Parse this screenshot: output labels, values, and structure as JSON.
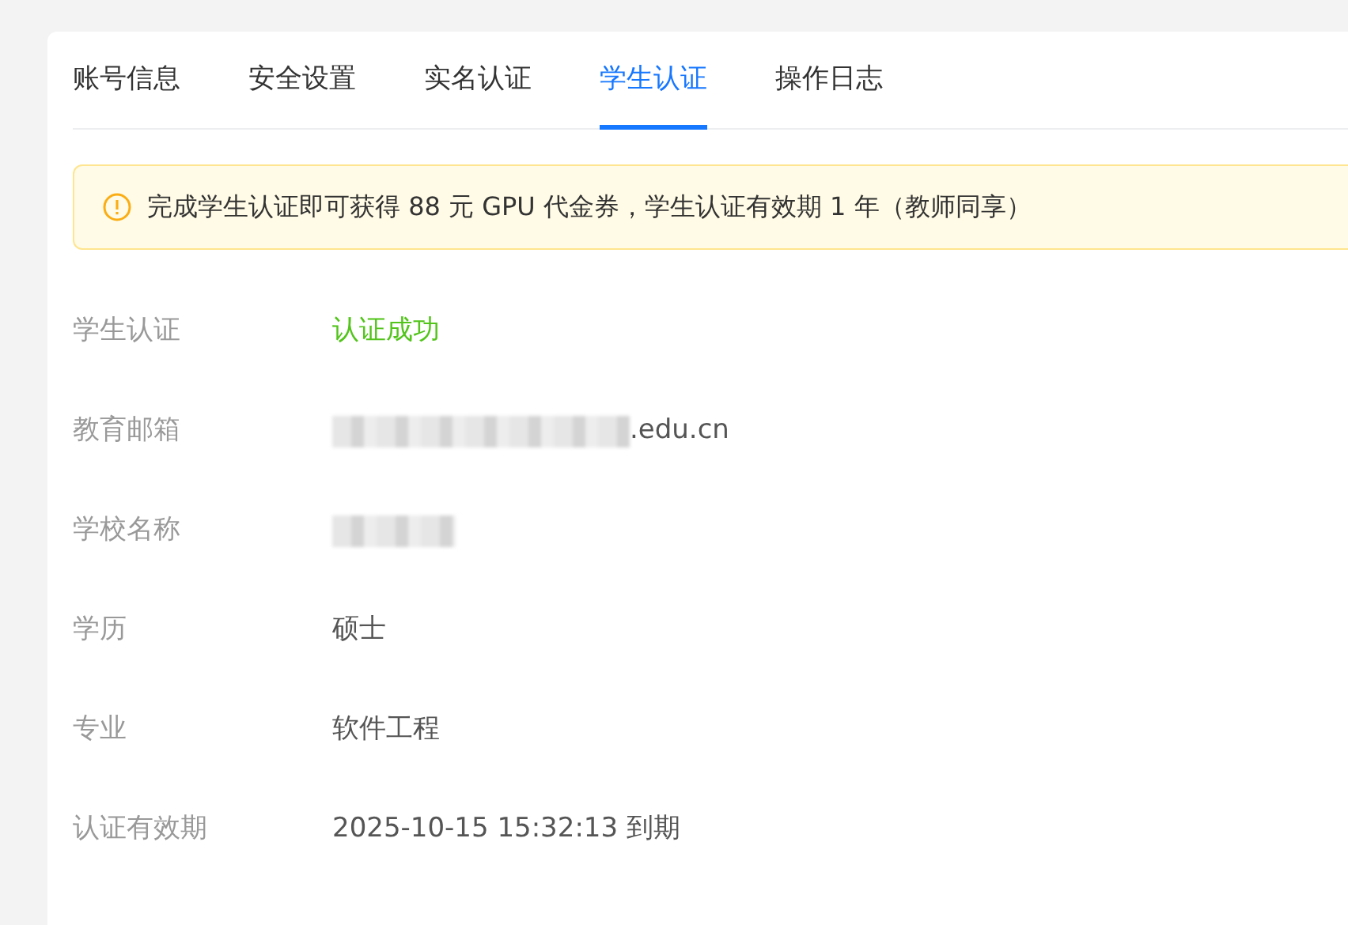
{
  "tabs": [
    {
      "label": "账号信息",
      "selected": false
    },
    {
      "label": "安全设置",
      "selected": false
    },
    {
      "label": "实名认证",
      "selected": false
    },
    {
      "label": "学生认证",
      "selected": true
    },
    {
      "label": "操作日志",
      "selected": false
    }
  ],
  "alert": {
    "kind": "warning",
    "text": "完成学生认证即可获得 88 元 GPU 代金券，学生认证有效期 1 年（教师同享）"
  },
  "fields": [
    {
      "label": "学生认证",
      "kind": "success",
      "value": "认证成功"
    },
    {
      "label": "教育邮箱",
      "kind": "redacted",
      "value": ".edu.cn"
    },
    {
      "label": "学校名称",
      "kind": "redacted"
    },
    {
      "label": "学历",
      "kind": "text",
      "value": "硕士"
    },
    {
      "label": "专业",
      "kind": "text",
      "value": "软件工程"
    },
    {
      "label": "认证有效期",
      "kind": "text",
      "value": "2025-10-15 15:32:13 到期"
    }
  ]
}
